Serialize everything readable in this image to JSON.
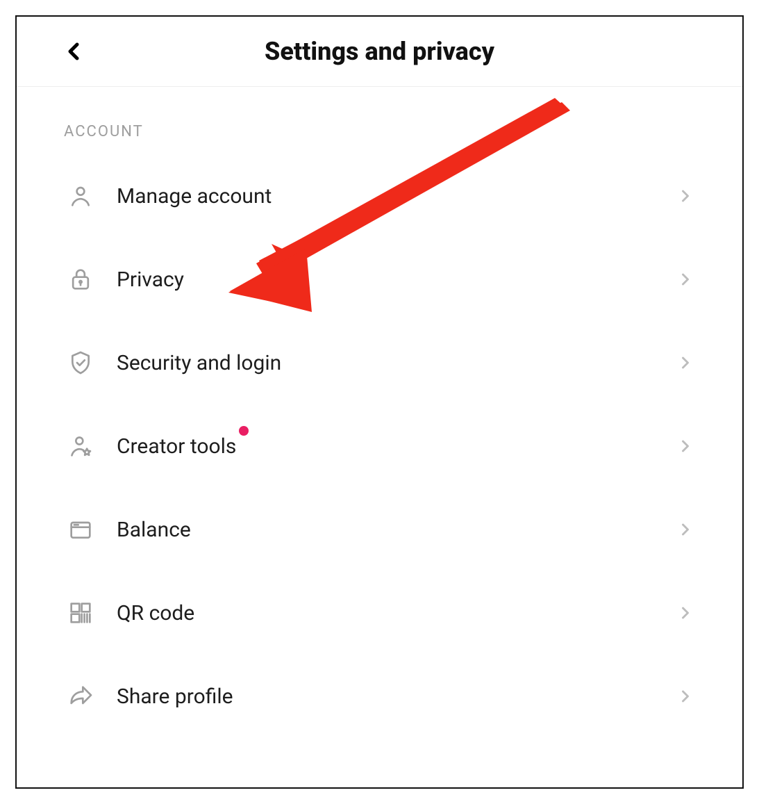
{
  "header": {
    "title": "Settings and privacy"
  },
  "section": {
    "label": "ACCOUNT"
  },
  "menu": {
    "items": [
      {
        "label": "Manage account",
        "icon": "person-icon",
        "badge": false
      },
      {
        "label": "Privacy",
        "icon": "lock-icon",
        "badge": false
      },
      {
        "label": "Security and login",
        "icon": "shield-check-icon",
        "badge": false
      },
      {
        "label": "Creator tools",
        "icon": "person-star-icon",
        "badge": true
      },
      {
        "label": "Balance",
        "icon": "wallet-icon",
        "badge": false
      },
      {
        "label": "QR code",
        "icon": "qr-code-icon",
        "badge": false
      },
      {
        "label": "Share profile",
        "icon": "share-icon",
        "badge": false
      }
    ]
  },
  "annotation": {
    "type": "arrow",
    "color": "#ef2a1a",
    "target": "menu-item-privacy"
  }
}
